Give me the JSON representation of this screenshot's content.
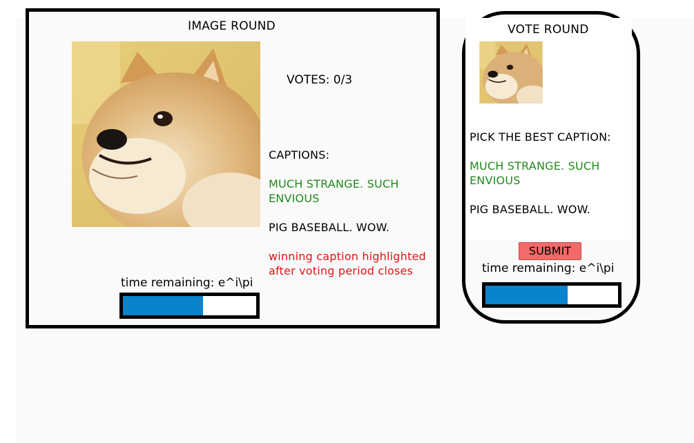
{
  "image_round": {
    "title": "IMAGE ROUND",
    "photo_icon": "doge-photo",
    "votes_label": "VOTES: 0/3",
    "captions_heading": "CAPTIONS:",
    "captions": [
      {
        "text": "MUCH STRANGE. SUCH ENVIOUS",
        "color": "#218a1c"
      },
      {
        "text": "PIG BASEBALL.  WOW.",
        "color": "#000000"
      }
    ],
    "note": "winning caption highlighted after voting period closes",
    "note_color": "#e31414",
    "time_label": "time remaining: e^i\\pi",
    "timer_progress": 0.6
  },
  "vote_round": {
    "title": "VOTE ROUND",
    "photo_icon": "doge-photo",
    "prompt": "PICK THE BEST CAPTION:",
    "options": [
      {
        "text": "MUCH STRANGE. SUCH ENVIOUS",
        "color": "#218a1c"
      },
      {
        "text": "PIG BASEBALL.  WOW.",
        "color": "#000000"
      }
    ],
    "submit_label": "SUBMIT",
    "submit_color": "#f26a6a",
    "time_label": "time remaining: e^i\\pi",
    "timer_progress": 0.62
  },
  "colors": {
    "progress_fill": "#0a83cd",
    "border": "#000000",
    "background": "#fafafa"
  }
}
